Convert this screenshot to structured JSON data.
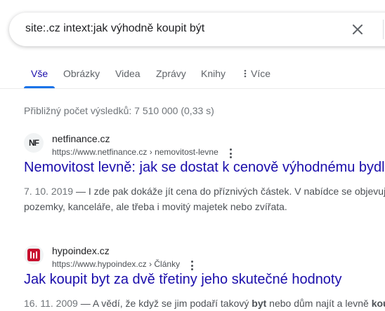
{
  "search": {
    "query": "site:.cz intext:jak výhodně koupit být"
  },
  "tabs": [
    {
      "label": "Vše"
    },
    {
      "label": "Obrázky"
    },
    {
      "label": "Videa"
    },
    {
      "label": "Zprávy"
    },
    {
      "label": "Knihy"
    },
    {
      "label": "Více"
    }
  ],
  "stats": "Přibližný počet výsledků: 7 510 000 (0,33 s)",
  "results": [
    {
      "site_name": "netfinance.cz",
      "url": "https://www.netfinance.cz › nemovitost-levne",
      "title": "Nemovitost levně: jak se dostat k cenově výhodnému bydl",
      "date": "7. 10. 2019",
      "snippet_line1": " — I zde pak dokáže jít cena do příznivých částek. V nabídce se objevuj",
      "snippet_line2": "pozemky, kanceláře, ale třeba i movitý majetek nebo zvířata.",
      "favicon_text": "NF"
    },
    {
      "site_name": "hypoindex.cz",
      "url": "https://www.hypoindex.cz › Články",
      "title": "Jak koupit byt za dvě třetiny jeho skutečné hodnoty",
      "date": "16. 11. 2009",
      "snippet_pre": " — A vědí, že když se jim podaří takový ",
      "snippet_bold": "byt",
      "snippet_post": " nebo dům najít a levně ",
      "snippet_bold2": "koupit",
      "favicon_color": "#c8102e"
    }
  ],
  "colors": {
    "link": "#1a0dab",
    "accent": "#1a73e8"
  }
}
